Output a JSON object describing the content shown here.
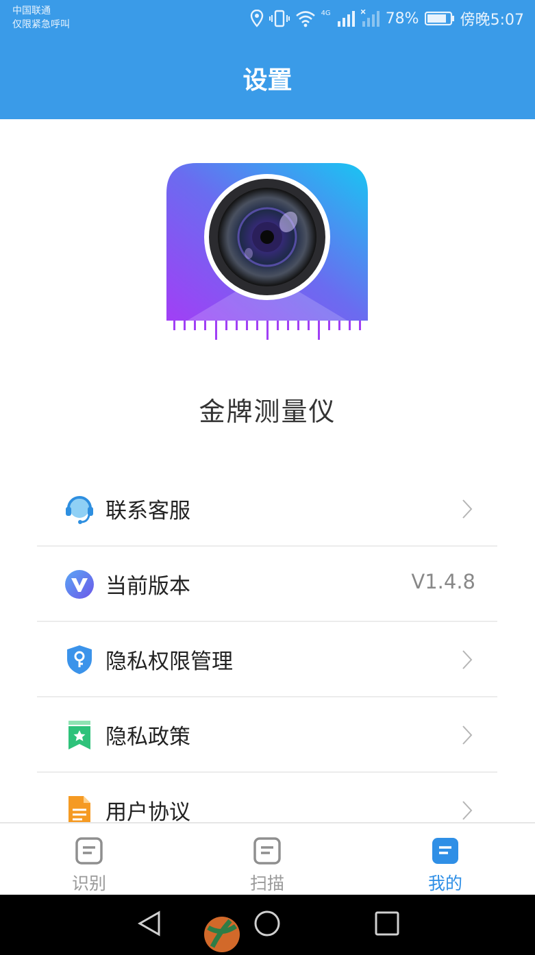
{
  "status_bar": {
    "carrier": "中国联通",
    "carrier_note": "仅限紧急呼叫",
    "battery": "78%",
    "time": "傍晚5:07",
    "network": "4G"
  },
  "header": {
    "title": "设置"
  },
  "app": {
    "name": "金牌测量仪"
  },
  "menu": {
    "items": [
      {
        "label": "联系客服",
        "icon": "headset-icon"
      },
      {
        "label": "当前版本",
        "value": "V1.4.8",
        "icon": "version-v-icon"
      },
      {
        "label": "隐私权限管理",
        "icon": "shield-key-icon"
      },
      {
        "label": "隐私政策",
        "icon": "bookmark-star-icon"
      },
      {
        "label": "用户协议",
        "icon": "document-icon"
      }
    ]
  },
  "tabs": [
    {
      "label": "识别",
      "icon": "doc-icon"
    },
    {
      "label": "扫描",
      "icon": "doc-icon"
    },
    {
      "label": "我的",
      "icon": "doc-icon",
      "active": true
    }
  ],
  "colors": {
    "primary": "#3a9be8",
    "active_tab": "#2f8fe6"
  }
}
